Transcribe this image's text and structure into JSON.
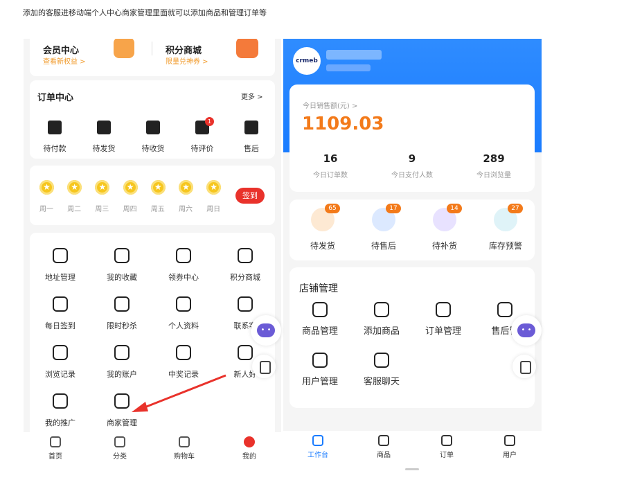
{
  "caption": "添加的客服进移动端个人中心商家管理里面就可以添加商品和管理订单等",
  "left": {
    "member": {
      "title": "会员中心",
      "sub": "查看新权益 >"
    },
    "points": {
      "title": "积分商城",
      "sub": "限量兑神券 >"
    },
    "orders": {
      "title": "订单中心",
      "more": "更多 >",
      "badge": "1",
      "items": [
        {
          "label": "待付款",
          "icon": "wallet-icon"
        },
        {
          "label": "待发货",
          "icon": "truck-icon"
        },
        {
          "label": "待收货",
          "icon": "box-icon"
        },
        {
          "label": "待评价",
          "icon": "comment-icon"
        },
        {
          "label": "售后",
          "icon": "return-icon"
        }
      ]
    },
    "checkin": {
      "days": [
        "周一",
        "周二",
        "周三",
        "周四",
        "周五",
        "周六",
        "周日"
      ],
      "button": "签到"
    },
    "services": [
      {
        "label": "地址管理",
        "icon": "location-icon"
      },
      {
        "label": "我的收藏",
        "icon": "star-icon"
      },
      {
        "label": "领券中心",
        "icon": "coupon-icon"
      },
      {
        "label": "积分商城",
        "icon": "gift-icon"
      },
      {
        "label": "每日签到",
        "icon": "calendar-icon"
      },
      {
        "label": "限时秒杀",
        "icon": "clock-icon"
      },
      {
        "label": "个人资料",
        "icon": "user-icon"
      },
      {
        "label": "联系客",
        "icon": "headset-icon"
      },
      {
        "label": "浏览记录",
        "icon": "document-icon"
      },
      {
        "label": "我的账户",
        "icon": "clipboard-icon"
      },
      {
        "label": "中奖记录",
        "icon": "record-icon"
      },
      {
        "label": "新人好",
        "icon": "bag-icon"
      },
      {
        "label": "我的推广",
        "icon": "promotion-icon"
      },
      {
        "label": "商家管理",
        "icon": "store-icon"
      }
    ],
    "tabs": [
      {
        "label": "首页",
        "icon": "home-icon"
      },
      {
        "label": "分类",
        "icon": "category-icon"
      },
      {
        "label": "购物车",
        "icon": "cart-icon"
      },
      {
        "label": "我的",
        "icon": "profile-icon"
      }
    ]
  },
  "right": {
    "logo": "crmeb",
    "sales": {
      "label": "今日销售额(元) >",
      "value": "1109.03"
    },
    "stats": [
      {
        "value": "16",
        "label": "今日订单数"
      },
      {
        "value": "9",
        "label": "今日支付人数"
      },
      {
        "value": "289",
        "label": "今日浏览量"
      }
    ],
    "todo": [
      {
        "label": "待发货",
        "badge": "65",
        "color": "#fde9d3"
      },
      {
        "label": "待售后",
        "badge": "17",
        "color": "#dce9ff"
      },
      {
        "label": "待补货",
        "badge": "14",
        "color": "#e8e2ff"
      },
      {
        "label": "库存预警",
        "badge": "27",
        "color": "#dff3f8"
      }
    ],
    "shop": {
      "title": "店铺管理",
      "items": [
        {
          "label": "商品管理",
          "icon": "bag-icon"
        },
        {
          "label": "添加商品",
          "icon": "bag-icon"
        },
        {
          "label": "订单管理",
          "icon": "clipboard-icon"
        },
        {
          "label": "售后管",
          "icon": "exchange-icon"
        },
        {
          "label": "用户管理",
          "icon": "users-icon"
        },
        {
          "label": "客服聊天",
          "icon": "chat-icon"
        }
      ]
    },
    "tabs": [
      {
        "label": "工作台",
        "icon": "desktop-icon"
      },
      {
        "label": "商品",
        "icon": "bag-icon"
      },
      {
        "label": "订单",
        "icon": "clipboard-icon"
      },
      {
        "label": "用户",
        "icon": "user-icon"
      }
    ]
  },
  "colors": {
    "accent": "#f37a1a",
    "primary": "#1a7cff",
    "red": "#e9322b"
  }
}
